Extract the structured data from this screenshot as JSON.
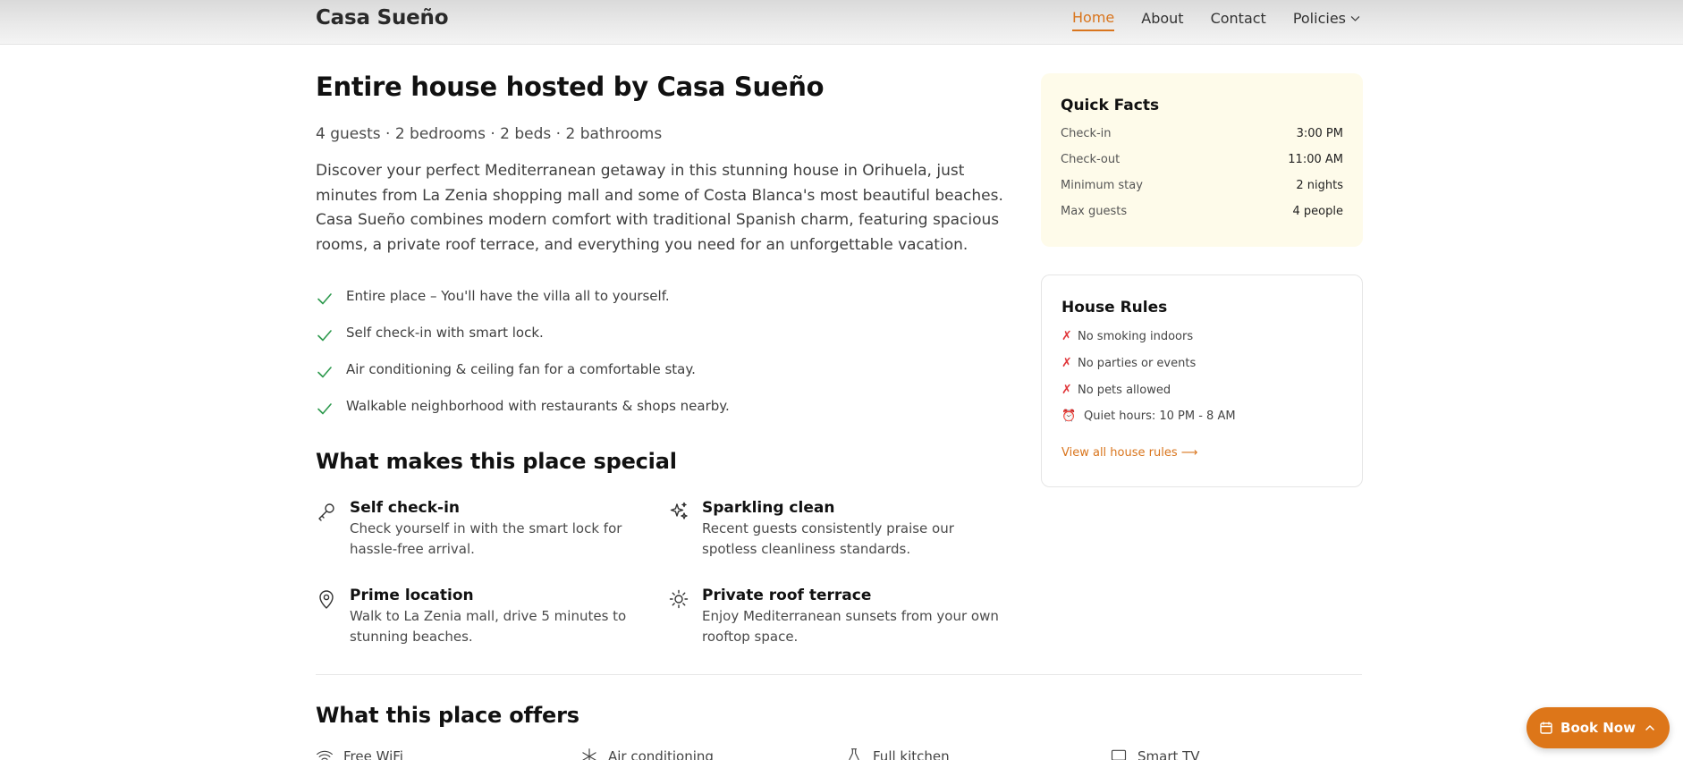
{
  "header": {
    "brand": "Casa Sueño",
    "nav": [
      {
        "label": "Home",
        "active": true
      },
      {
        "label": "About"
      },
      {
        "label": "Contact"
      },
      {
        "label": "Policies",
        "icon": "chevron-down-icon"
      }
    ]
  },
  "listing": {
    "title": "Entire house hosted by Casa Sueño",
    "stats": "4 guests · 2 bedrooms · 2 beds · 2 bathrooms",
    "description": "Discover your perfect Mediterranean getaway in this stunning house in Orihuela, just minutes from La Zenia shopping mall and some of Costa Blanca's most beautiful beaches. Casa Sueño combines modern comfort with traditional Spanish charm, featuring spacious rooms, a private roof terrace, and everything you need for an unforgettable vacation.",
    "highlights": [
      "Entire place – You'll have the villa all to yourself.",
      "Self check-in with smart lock.",
      "Air conditioning & ceiling fan for a comfortable stay.",
      "Walkable neighborhood with restaurants & shops nearby."
    ]
  },
  "special": {
    "title": "What makes this place special",
    "features": [
      {
        "icon": "key-icon",
        "title": "Self check-in",
        "desc": "Check yourself in with the smart lock for hassle-free arrival."
      },
      {
        "icon": "sparkles-icon",
        "title": "Sparkling clean",
        "desc": "Recent guests consistently praise our spotless cleanliness standards."
      },
      {
        "icon": "map-pin-icon",
        "title": "Prime location",
        "desc": "Walk to La Zenia mall, drive 5 minutes to stunning beaches."
      },
      {
        "icon": "sun-icon",
        "title": "Private roof terrace",
        "desc": "Enjoy Mediterranean sunsets from your own rooftop space."
      }
    ]
  },
  "offers": {
    "title": "What this place offers",
    "items": [
      {
        "icon": "wifi-icon",
        "label": "Free WiFi"
      },
      {
        "icon": "snowflake-icon",
        "label": "Air conditioning"
      },
      {
        "icon": "kitchen-icon",
        "label": "Full kitchen"
      },
      {
        "icon": "tv-icon",
        "label": "Smart TV"
      }
    ]
  },
  "quick_facts": {
    "title": "Quick Facts",
    "rows": [
      {
        "label": "Check-in",
        "value": "3:00 PM"
      },
      {
        "label": "Check-out",
        "value": "11:00 AM"
      },
      {
        "label": "Minimum stay",
        "value": "2 nights"
      },
      {
        "label": "Max guests",
        "value": "4 people"
      }
    ]
  },
  "house_rules": {
    "title": "House Rules",
    "rules": [
      {
        "mark": "✗",
        "label": "No smoking indoors"
      },
      {
        "mark": "✗",
        "label": "No parties or events"
      },
      {
        "mark": "✗",
        "label": "No pets allowed"
      },
      {
        "mark": "⏰",
        "label": "Quiet hours: 10 PM - 8 AM"
      }
    ],
    "link": "View all house rules ⟶"
  },
  "book_button": {
    "label": "Book Now"
  },
  "colors": {
    "accent": "#dd7619",
    "check": "#2e9a4e",
    "x_mark": "#e0363a",
    "facts_bg": "#fefbea"
  }
}
